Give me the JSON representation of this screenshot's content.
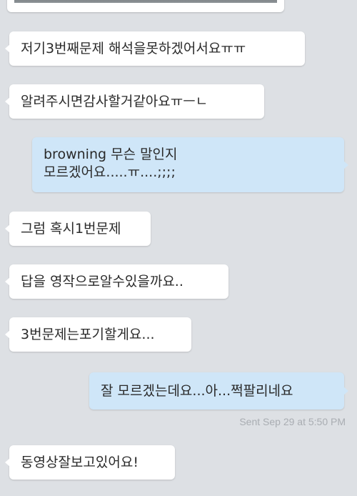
{
  "messages": [
    {
      "direction": "in",
      "text": "저기3번째문제 해석을못하겠어서요ㅠㅠ"
    },
    {
      "direction": "in",
      "text": "알려주시면감사할거같아요ㅠㅡㄴ"
    },
    {
      "direction": "out",
      "lines": [
        "browning 무슨 말인지",
        "모르겠어요.....ㅠ....;;;;"
      ]
    },
    {
      "direction": "in",
      "text": "그럼 혹시1번문제"
    },
    {
      "direction": "in",
      "text": "답을 영작으로알수있을까요.."
    },
    {
      "direction": "in",
      "text": "3번문제는포기할게요..."
    },
    {
      "direction": "out",
      "text": "잘 모르겠는데요...아...쩍팔리네요"
    },
    {
      "direction": "in",
      "text": "동영상잘보고있어요!"
    }
  ],
  "sent_status": "Sent Sep 29 at 5:50 PM",
  "colors": {
    "background": "#dde0e4",
    "incoming_bubble": "#ffffff",
    "outgoing_bubble": "#cfe6f8"
  }
}
